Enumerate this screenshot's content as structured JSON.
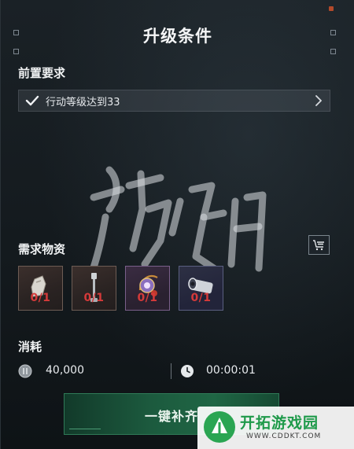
{
  "title": "升级条件",
  "prerequisites": {
    "heading": "前置要求",
    "items": [
      {
        "text": "行动等级达到33",
        "status": "met"
      }
    ]
  },
  "materials": {
    "heading": "需求物资",
    "filter_icon": "cart-list-icon",
    "items": [
      {
        "icon": "cloth-part-icon",
        "count": "0/1"
      },
      {
        "icon": "metal-rod-icon",
        "count": "0/1"
      },
      {
        "icon": "ornament-icon",
        "count": "0/1"
      },
      {
        "icon": "cannon-barrel-icon",
        "count": "0/1"
      }
    ]
  },
  "cost": {
    "heading": "消耗",
    "currency_icon": "coin-icon",
    "currency_value": "40,000",
    "time_icon": "clock-icon",
    "time_value": "00:00:01"
  },
  "action": {
    "supply_label": "一键补齐"
  },
  "watermark": {
    "text": "游侠网"
  },
  "logo": {
    "name": "开拓游戏园",
    "url": "WWW.CDDKT.COM"
  },
  "colors": {
    "accent_green": "#1f6644",
    "count_red": "#d43a3a",
    "check_white": "#f0f2f4"
  }
}
